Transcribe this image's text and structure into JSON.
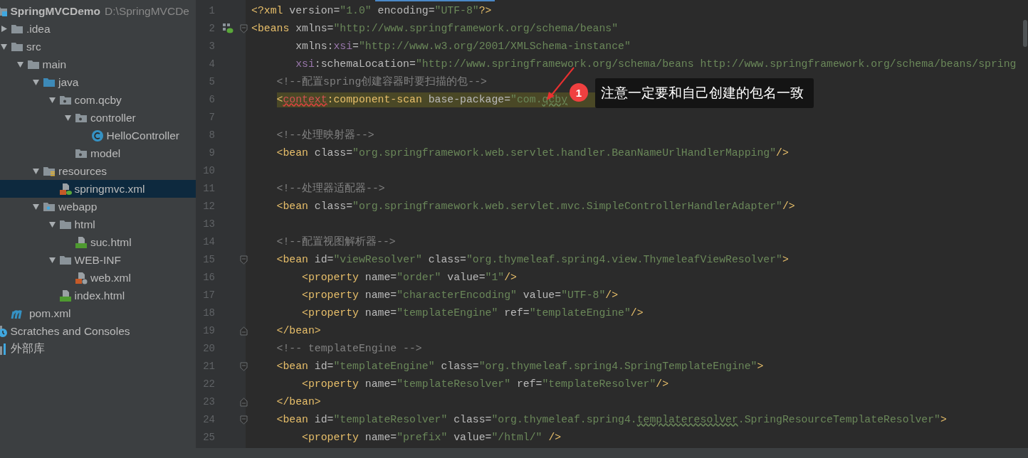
{
  "project_tree": {
    "items": [
      {
        "label": "SpringMVCDemo",
        "path": "D:\\SpringMVCDe",
        "kind": "module",
        "selected": false,
        "children": [
          {
            "label": ".idea",
            "kind": "folder",
            "expanded": false,
            "selected": false
          },
          {
            "label": "src",
            "kind": "folder",
            "expanded": true,
            "selected": false,
            "children": [
              {
                "label": "main",
                "kind": "folder",
                "expanded": true,
                "selected": false,
                "children": [
                  {
                    "label": "java",
                    "kind": "source",
                    "expanded": true,
                    "selected": false,
                    "children": [
                      {
                        "label": "com.qcby",
                        "kind": "package",
                        "expanded": true,
                        "selected": false,
                        "children": [
                          {
                            "label": "controller",
                            "kind": "package",
                            "expanded": true,
                            "selected": false,
                            "children": [
                              {
                                "label": "HelloController",
                                "kind": "class",
                                "selected": false
                              }
                            ]
                          },
                          {
                            "label": "model",
                            "kind": "package",
                            "selected": false
                          }
                        ]
                      }
                    ]
                  },
                  {
                    "label": "resources",
                    "kind": "resources",
                    "expanded": true,
                    "selected": false,
                    "children": [
                      {
                        "label": "springmvc.xml",
                        "kind": "spring-xml",
                        "selected": true
                      }
                    ]
                  },
                  {
                    "label": "webapp",
                    "kind": "web",
                    "expanded": true,
                    "selected": false,
                    "children": [
                      {
                        "label": "html",
                        "kind": "folder",
                        "expanded": true,
                        "selected": false,
                        "children": [
                          {
                            "label": "suc.html",
                            "kind": "html",
                            "selected": false
                          }
                        ]
                      },
                      {
                        "label": "WEB-INF",
                        "kind": "folder",
                        "expanded": true,
                        "selected": false,
                        "children": [
                          {
                            "label": "web.xml",
                            "kind": "web-xml",
                            "selected": false
                          }
                        ]
                      },
                      {
                        "label": "index.html",
                        "kind": "html",
                        "selected": false
                      }
                    ]
                  }
                ]
              }
            ]
          },
          {
            "label": "pom.xml",
            "kind": "maven",
            "selected": false
          }
        ]
      },
      {
        "label": "Scratches and Consoles",
        "kind": "scratches",
        "selected": false
      },
      {
        "label": "外部库",
        "kind": "library",
        "selected": false
      }
    ]
  },
  "editor": {
    "lines": [
      {
        "number": "1",
        "highlighted": false,
        "tokens": [
          {
            "kind": "tag",
            "text": "<?xml"
          },
          {
            "kind": "attr",
            "text": " version="
          },
          {
            "kind": "string",
            "text": "\"1.0\""
          },
          {
            "kind": "attr",
            "text": " encoding="
          },
          {
            "kind": "string",
            "text": "\"UTF-8\""
          },
          {
            "kind": "tag",
            "text": "?>"
          }
        ]
      },
      {
        "number": "2",
        "highlighted": false,
        "markers": [
          {
            "kind": "bean"
          },
          {
            "kind": "fold-start"
          }
        ],
        "tokens": [
          {
            "kind": "tag",
            "text": "<beans"
          },
          {
            "kind": "attr",
            "text": " xmlns="
          },
          {
            "kind": "string",
            "text": "\"http://www.springframework.org/schema/beans\""
          }
        ]
      },
      {
        "number": "3",
        "highlighted": false,
        "tokens": [
          {
            "kind": "attr",
            "text": "       xmlns:"
          },
          {
            "kind": "ns",
            "text": "xsi"
          },
          {
            "kind": "attr",
            "text": "="
          },
          {
            "kind": "string",
            "text": "\"http://www.w3.org/2001/XMLSchema-instance\""
          }
        ]
      },
      {
        "number": "4",
        "highlighted": false,
        "tokens": [
          {
            "kind": "ns",
            "text": "       xsi"
          },
          {
            "kind": "attr",
            "text": ":schemaLocation="
          },
          {
            "kind": "string",
            "text": "\"http://www.springframework.org/schema/beans http://www.springframework.org/schema/beans/spring"
          }
        ]
      },
      {
        "number": "5",
        "highlighted": false,
        "tokens": [
          {
            "kind": "comment",
            "text": "    <!--配置spring创建容器时要扫描的包-->"
          }
        ]
      },
      {
        "number": "6",
        "highlighted": true,
        "tokens": [
          {
            "kind": "tag",
            "text": "    <"
          },
          {
            "kind": "error",
            "text": "context",
            "wavy": true
          },
          {
            "kind": "tag",
            "text": ":component-scan"
          },
          {
            "kind": "attr",
            "text": " base-package="
          },
          {
            "kind": "string",
            "text": "\"com."
          },
          {
            "kind": "string",
            "text": "qcby",
            "wavy": true
          }
        ]
      },
      {
        "number": "7",
        "highlighted": false
      },
      {
        "number": "8",
        "highlighted": false,
        "tokens": [
          {
            "kind": "comment",
            "text": "    <!--处理映射器-->"
          }
        ]
      },
      {
        "number": "9",
        "highlighted": false,
        "tokens": [
          {
            "kind": "tag",
            "text": "    <bean"
          },
          {
            "kind": "attr",
            "text": " class="
          },
          {
            "kind": "string",
            "text": "\"org.springframework.web.servlet.handler.BeanNameUrlHandlerMapping\""
          },
          {
            "kind": "tag",
            "text": "/>"
          }
        ]
      },
      {
        "number": "10",
        "highlighted": false
      },
      {
        "number": "11",
        "highlighted": false,
        "tokens": [
          {
            "kind": "comment",
            "text": "    <!--处理器适配器-->"
          }
        ]
      },
      {
        "number": "12",
        "highlighted": false,
        "tokens": [
          {
            "kind": "tag",
            "text": "    <bean"
          },
          {
            "kind": "attr",
            "text": " class="
          },
          {
            "kind": "string",
            "text": "\"org.springframework.web.servlet.mvc.SimpleControllerHandlerAdapter\""
          },
          {
            "kind": "tag",
            "text": "/>"
          }
        ]
      },
      {
        "number": "13",
        "highlighted": false
      },
      {
        "number": "14",
        "highlighted": false,
        "tokens": [
          {
            "kind": "comment",
            "text": "    <!--配置视图解析器-->"
          }
        ]
      },
      {
        "number": "15",
        "highlighted": false,
        "markers": [
          {
            "kind": "fold-start"
          }
        ],
        "tokens": [
          {
            "kind": "tag",
            "text": "    <bean"
          },
          {
            "kind": "attr",
            "text": " id="
          },
          {
            "kind": "string",
            "text": "\"viewResolver\""
          },
          {
            "kind": "attr",
            "text": " class="
          },
          {
            "kind": "string",
            "text": "\"org.thymeleaf.spring4.view.ThymeleafViewResolver\""
          },
          {
            "kind": "tag",
            "text": ">"
          }
        ]
      },
      {
        "number": "16",
        "highlighted": false,
        "tokens": [
          {
            "kind": "tag",
            "text": "        <property"
          },
          {
            "kind": "attr",
            "text": " name="
          },
          {
            "kind": "string",
            "text": "\"order\""
          },
          {
            "kind": "attr",
            "text": " value="
          },
          {
            "kind": "string",
            "text": "\"1\""
          },
          {
            "kind": "tag",
            "text": "/>"
          }
        ]
      },
      {
        "number": "17",
        "highlighted": false,
        "tokens": [
          {
            "kind": "tag",
            "text": "        <property"
          },
          {
            "kind": "attr",
            "text": " name="
          },
          {
            "kind": "string",
            "text": "\"characterEncoding\""
          },
          {
            "kind": "attr",
            "text": " value="
          },
          {
            "kind": "string",
            "text": "\"UTF-8\""
          },
          {
            "kind": "tag",
            "text": "/>"
          }
        ]
      },
      {
        "number": "18",
        "highlighted": false,
        "tokens": [
          {
            "kind": "tag",
            "text": "        <property"
          },
          {
            "kind": "attr",
            "text": " name="
          },
          {
            "kind": "string",
            "text": "\"templateEngine\""
          },
          {
            "kind": "attr",
            "text": " ref="
          },
          {
            "kind": "string",
            "text": "\"templateEngine\""
          },
          {
            "kind": "tag",
            "text": "/>"
          }
        ]
      },
      {
        "number": "19",
        "highlighted": false,
        "markers": [
          {
            "kind": "fold-end"
          }
        ],
        "tokens": [
          {
            "kind": "tag",
            "text": "    </bean>"
          }
        ]
      },
      {
        "number": "20",
        "highlighted": false,
        "tokens": [
          {
            "kind": "comment",
            "text": "    <!-- templateEngine -->"
          }
        ]
      },
      {
        "number": "21",
        "highlighted": false,
        "markers": [
          {
            "kind": "fold-start"
          }
        ],
        "tokens": [
          {
            "kind": "tag",
            "text": "    <bean"
          },
          {
            "kind": "attr",
            "text": " id="
          },
          {
            "kind": "string",
            "text": "\"templateEngine\""
          },
          {
            "kind": "attr",
            "text": " class="
          },
          {
            "kind": "string",
            "text": "\"org.thymeleaf.spring4.SpringTemplateEngine\""
          },
          {
            "kind": "tag",
            "text": ">"
          }
        ]
      },
      {
        "number": "22",
        "highlighted": false,
        "tokens": [
          {
            "kind": "tag",
            "text": "        <property"
          },
          {
            "kind": "attr",
            "text": " name="
          },
          {
            "kind": "string",
            "text": "\"templateResolver\""
          },
          {
            "kind": "attr",
            "text": " ref="
          },
          {
            "kind": "string",
            "text": "\"templateResolver\""
          },
          {
            "kind": "tag",
            "text": "/>"
          }
        ]
      },
      {
        "number": "23",
        "highlighted": false,
        "markers": [
          {
            "kind": "fold-end"
          }
        ],
        "tokens": [
          {
            "kind": "tag",
            "text": "    </bean>"
          }
        ]
      },
      {
        "number": "24",
        "highlighted": false,
        "markers": [
          {
            "kind": "fold-start"
          }
        ],
        "tokens": [
          {
            "kind": "tag",
            "text": "    <bean"
          },
          {
            "kind": "attr",
            "text": " id="
          },
          {
            "kind": "string",
            "text": "\"templateResolver\""
          },
          {
            "kind": "attr",
            "text": " class="
          },
          {
            "kind": "string",
            "text": "\"org.thymeleaf.spring4."
          },
          {
            "kind": "string",
            "text": "templateresolver",
            "wavy": true
          },
          {
            "kind": "string",
            "text": ".SpringResourceTemplateResolver\""
          },
          {
            "kind": "tag",
            "text": ">"
          }
        ]
      },
      {
        "number": "25",
        "highlighted": false,
        "tokens": [
          {
            "kind": "tag",
            "text": "        <property"
          },
          {
            "kind": "attr",
            "text": " name="
          },
          {
            "kind": "string",
            "text": "\"prefix\""
          },
          {
            "kind": "attr",
            "text": " value="
          },
          {
            "kind": "string",
            "text": "\"/html/\""
          },
          {
            "kind": "tag",
            "text": " />"
          }
        ]
      }
    ]
  },
  "annotation": {
    "badge": "1",
    "note": "注意一定要和自己创建的包名一致"
  }
}
